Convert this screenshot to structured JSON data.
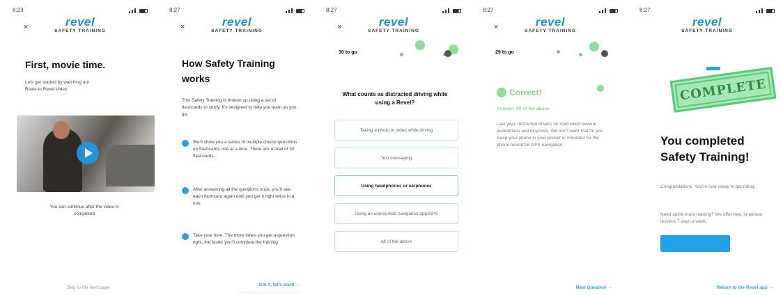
{
  "screens": [
    {
      "time": "8:23",
      "logo": "revel",
      "subtitle": "SAFETY TRAINING",
      "close": "×",
      "title": "First, movie time.",
      "body": "Lets get started by watching our Revel-in Revel Video",
      "note": "You can continue after the video is completed",
      "footer_link": "Skip to the next page"
    },
    {
      "time": "8:27",
      "logo": "revel",
      "subtitle": "SAFETY TRAINING",
      "close": "×",
      "title": "How Safety Training works",
      "intro": "This Safety Training is broken up using a set of flashcards to study. It's designed to help you learn as you go.",
      "bullets": [
        "We'll show you a series of multiple choice questions on flashcards one at a time. There are a total of 30 flashcards.",
        "After answering all the questions once, you'll see each flashcard again until you get it right twice in a row.",
        "Take your time. The more times you get a question right, the faster you'll complete the training."
      ],
      "footer_link": "Got it, let's start! →"
    },
    {
      "time": "8:27",
      "logo": "revel",
      "subtitle": "SAFETY TRAINING",
      "close": "×",
      "progress_label": "30 to go",
      "question": "What counts as distracted driving while using a Revel?",
      "options": [
        "Taking a photo or video while driving",
        "Text messaging",
        "Using headphones or earphones",
        "Using an unmounted navigation app/GPS",
        "All of the above"
      ],
      "selected_option": 2
    },
    {
      "time": "8:27",
      "logo": "revel",
      "subtitle": "SAFETY TRAINING",
      "close": "×",
      "progress_label": "29 to go",
      "result_title": "Correct!",
      "result_sub": "Answer: All of the above",
      "explanation": "Last year, distracted drivers on road killed several pedestrians and bicyclists. We don't want that for you. Keep your phone in your pocket or mounted for the phone mount for GPS navigation.",
      "footer_link": "Next Question →"
    },
    {
      "time": "8:27",
      "logo": "revel",
      "subtitle": "SAFETY TRAINING",
      "close": "",
      "stamp": "COMPLETE",
      "title": "You completed Safety Training!",
      "body1": "Congratulations. You're now ready to get riding.",
      "body2": "Need some more training? We offer free, in-person lessons 7 days a week.",
      "footer_link": "Return to the Revel app →"
    }
  ],
  "colors": {
    "brand_blue": "#1f8fd6",
    "accent_green": "#7fd88a",
    "link_blue": "#27a3e0"
  }
}
